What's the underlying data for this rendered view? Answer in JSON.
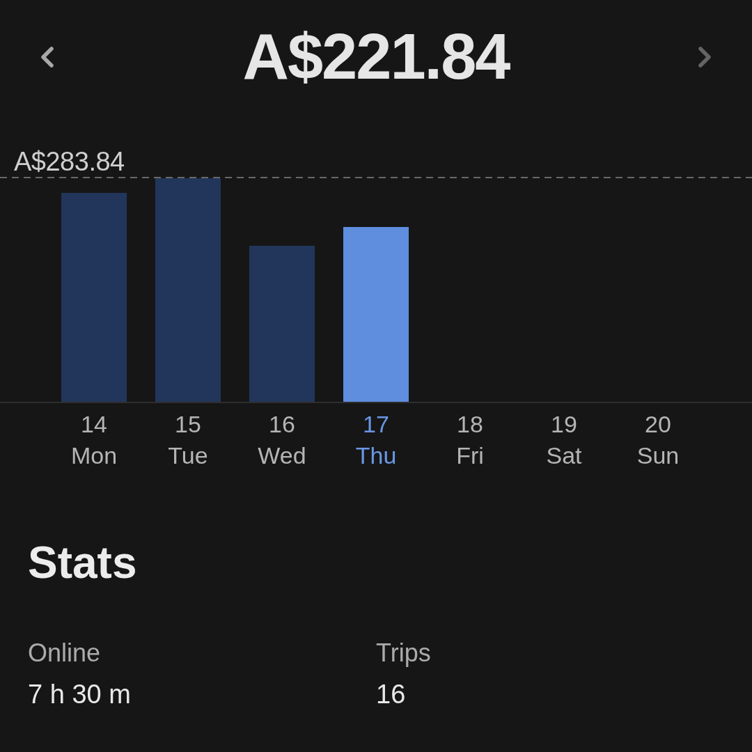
{
  "header": {
    "total": "A$221.84",
    "previous": {
      "disabled": false
    },
    "next": {
      "disabled": true
    }
  },
  "chart": {
    "max_label": "A$283.84",
    "days": [
      {
        "date": "14",
        "day": "Mon",
        "selected": false
      },
      {
        "date": "15",
        "day": "Tue",
        "selected": false
      },
      {
        "date": "16",
        "day": "Wed",
        "selected": false
      },
      {
        "date": "17",
        "day": "Thu",
        "selected": true
      },
      {
        "date": "18",
        "day": "Fri",
        "selected": false
      },
      {
        "date": "19",
        "day": "Sat",
        "selected": false
      },
      {
        "date": "20",
        "day": "Sun",
        "selected": false
      }
    ]
  },
  "stats": {
    "title": "Stats",
    "items": [
      {
        "label": "Online",
        "value": "7 h 30 m"
      },
      {
        "label": "Trips",
        "value": "16"
      }
    ]
  }
}
